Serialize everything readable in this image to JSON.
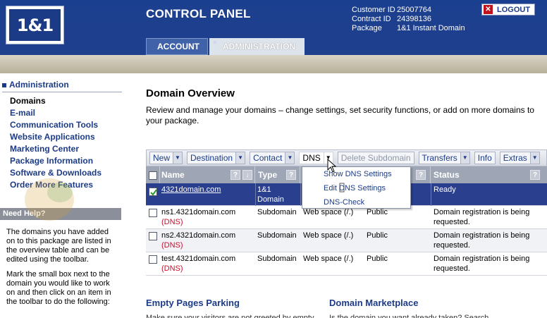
{
  "header": {
    "logo_text": "1&1",
    "title": "CONTROL PANEL",
    "customer_id_label": "Customer ID",
    "customer_id": "25007764",
    "contract_id_label": "Contract ID",
    "contract_id": "24398136",
    "package_label": "Package",
    "package": "1&1 Instant Domain",
    "logout": "LOGOUT",
    "tabs": [
      "ACCOUNT",
      "ADMINISTRATION"
    ]
  },
  "sidebar": {
    "heading": "Administration",
    "items": [
      {
        "label": "Domains",
        "active": true
      },
      {
        "label": "E-mail"
      },
      {
        "label": "Communication Tools"
      },
      {
        "label": "Website Applications"
      },
      {
        "label": "Marketing Center"
      },
      {
        "label": "Package Information"
      },
      {
        "label": "Software & Downloads"
      },
      {
        "label": "Order More Features"
      }
    ],
    "help_title": "Need Help?",
    "help_p1": "The domains you have added on to this package are listed in the overview table and can be edited using the toolbar.",
    "help_p2": "Mark the small box next to the domain you would like to work on and then click on an item in the toolbar to do the following:"
  },
  "main": {
    "title": "Domain Overview",
    "intro_line1": "Review and manage your domains – change settings, set security functions, or add on more domains to",
    "intro_line2": "your package.",
    "toolbar": {
      "new": "New",
      "destination": "Destination",
      "contact": "Contact",
      "dns": "DNS",
      "delete_subdomain": "Delete Subdomain",
      "transfers": "Transfers",
      "info": "Info",
      "extras": "Extras"
    },
    "columns": {
      "name": "Name",
      "type": "Type",
      "status": "Status"
    },
    "rows": [
      {
        "name": "4321domain.com",
        "dns": "",
        "type_line1": "1&1",
        "type_line2": "Domain",
        "destination": "",
        "ssl": "",
        "status_line1": "Ready",
        "status_line2": ""
      },
      {
        "name": "ns1.4321domain.com",
        "dns": "(DNS)",
        "type_line1": "Subdomain",
        "type_line2": "",
        "destination": "Web space (/.)",
        "ssl": "Public",
        "status_line1": "Domain registration is being",
        "status_line2": "requested."
      },
      {
        "name": "ns2.4321domain.com",
        "dns": "(DNS)",
        "type_line1": "Subdomain",
        "type_line2": "",
        "destination": "Web space (/.)",
        "ssl": "Public",
        "status_line1": "Domain registration is being",
        "status_line2": "requested."
      },
      {
        "name": "test.4321domain.com",
        "dns": "(DNS)",
        "type_line1": "Subdomain",
        "type_line2": "",
        "destination": "Web space (/.)",
        "ssl": "Public",
        "status_line1": "Domain registration is being",
        "status_line2": "requested."
      }
    ],
    "dns_menu": [
      "Show DNS Settings",
      "Edit DNS Settings",
      "DNS-Check"
    ],
    "section_left": "Empty Pages Parking",
    "section_left_sub": "Make sure your visitors are not greeted by empty",
    "section_right": "Domain Marketplace",
    "section_right_sub": "Is the domain you want already taken? Search"
  },
  "colors": {
    "header_blue": "#1c3b87",
    "selected_row": "#2a3f8d",
    "dns_red": "#c8102e",
    "grid_header": "#9ea6b5"
  },
  "icons": [
    "logout-x-icon",
    "dropdown-arrow-icon",
    "help-question-icon",
    "checkbox-icon",
    "sort-down-icon",
    "mouse-cursor-icon"
  ]
}
